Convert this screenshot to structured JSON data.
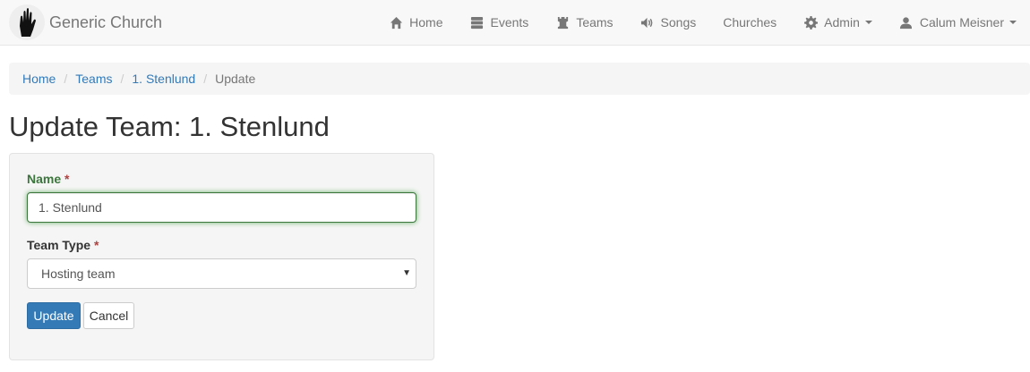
{
  "brand": {
    "name": "Generic Church",
    "logo_icon": "praying-hands-icon"
  },
  "nav": {
    "items": [
      {
        "label": "Home",
        "icon": "home-icon"
      },
      {
        "label": "Events",
        "icon": "tasks-icon"
      },
      {
        "label": "Teams",
        "icon": "tower-icon"
      },
      {
        "label": "Songs",
        "icon": "volume-icon"
      },
      {
        "label": "Churches"
      },
      {
        "label": "Admin",
        "icon": "cog-icon",
        "dropdown": true
      },
      {
        "label": "Calum Meisner",
        "icon": "user-icon",
        "dropdown": true
      }
    ]
  },
  "breadcrumb": {
    "items": [
      "Home",
      "Teams",
      "1. Stenlund"
    ],
    "active": "Update",
    "separator": "/"
  },
  "page": {
    "title": "Update Team: 1. Stenlund"
  },
  "form": {
    "name_label": "Name",
    "name_value": "1. Stenlund",
    "type_label": "Team Type",
    "type_value": "Hosting team",
    "required_marker": "*",
    "submit_label": "Update",
    "cancel_label": "Cancel"
  },
  "colors": {
    "link": "#337ab7",
    "primary": "#337ab7",
    "success": "#3c763d",
    "required": "#a94442",
    "navbar_bg": "#f8f8f8"
  }
}
